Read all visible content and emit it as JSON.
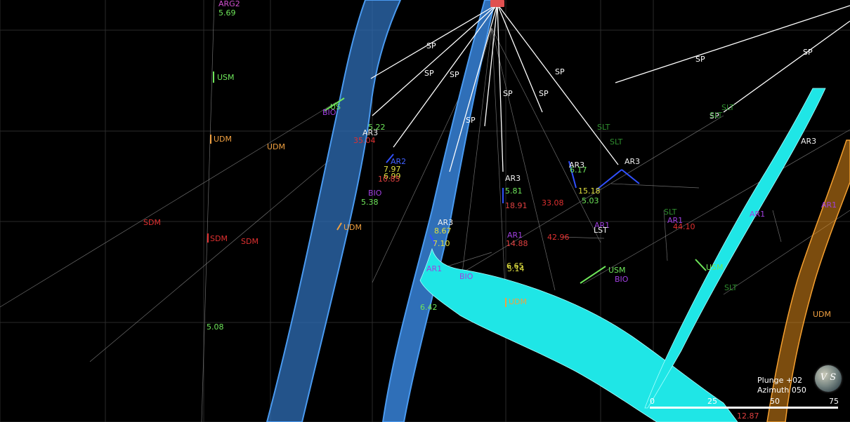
{
  "viewer": {
    "orientation": {
      "plunge_label": "Plunge +02",
      "azimuth_label": "Azimuth 050"
    },
    "compass_label": "V S",
    "scale_bar": {
      "ticks": [
        "0",
        "25",
        "50",
        "75"
      ]
    }
  },
  "colors": {
    "background": "#000000",
    "drillhole_trace": "#ffffff",
    "blue_surface": "#2f6fb8",
    "cyan_surface": "#1fe6e6",
    "orange_surface": "#e08a1a",
    "collar": "#e05050",
    "grid": "#2a2a2a"
  },
  "drillholes": [
    {
      "id": "h1",
      "label": "SP"
    },
    {
      "id": "h2",
      "label": "SP"
    },
    {
      "id": "h3",
      "label": "SP"
    },
    {
      "id": "h4",
      "label": "SP"
    },
    {
      "id": "h5",
      "label": "SP"
    },
    {
      "id": "h6",
      "label": "SP"
    },
    {
      "id": "h7",
      "label": "SP"
    },
    {
      "id": "h8",
      "label": "SP"
    },
    {
      "id": "h9",
      "label": "SP"
    },
    {
      "id": "h10",
      "label": "SP"
    }
  ],
  "labels": [
    {
      "text": "ARG2",
      "color": "#d050d0"
    },
    {
      "text": "5.69",
      "color": "#6ee65a"
    },
    {
      "text": "USM",
      "color": "#6ee65a"
    },
    {
      "text": "UDM",
      "color": "#f0a040"
    },
    {
      "text": "UDM",
      "color": "#f0a040"
    },
    {
      "text": "SDM",
      "color": "#e03030"
    },
    {
      "text": "SDM",
      "color": "#e03030"
    },
    {
      "text": "SDM",
      "color": "#e03030"
    },
    {
      "text": "5.08",
      "color": "#6ee65a"
    },
    {
      "text": "US",
      "color": "#6ee65a"
    },
    {
      "text": "BIO",
      "color": "#a040e0"
    },
    {
      "text": "AR3",
      "color": "#f0f0f0"
    },
    {
      "text": "35.04",
      "color": "#e03030"
    },
    {
      "text": "5.22",
      "color": "#6ee65a"
    },
    {
      "text": "AR2",
      "color": "#4060ff"
    },
    {
      "text": "7.97",
      "color": "#e0e040"
    },
    {
      "text": "6.99",
      "color": "#e0e040"
    },
    {
      "text": "10.85",
      "color": "#e04040"
    },
    {
      "text": "BIO",
      "color": "#a040e0"
    },
    {
      "text": "5.38",
      "color": "#6ee65a"
    },
    {
      "text": "UDM",
      "color": "#f0a040"
    },
    {
      "text": "AR3",
      "color": "#f0f0f0"
    },
    {
      "text": "8.67",
      "color": "#e0e040"
    },
    {
      "text": "7.10",
      "color": "#e0e040"
    },
    {
      "text": "AR1",
      "color": "#a040e0"
    },
    {
      "text": "BIO",
      "color": "#a040e0"
    },
    {
      "text": "6.42",
      "color": "#6ee65a"
    },
    {
      "text": "AR3",
      "color": "#f0f0f0"
    },
    {
      "text": "5.81",
      "color": "#6ee65a"
    },
    {
      "text": "18.91",
      "color": "#e04040"
    },
    {
      "text": "33.08",
      "color": "#e03030"
    },
    {
      "text": "AR1",
      "color": "#a040e0"
    },
    {
      "text": "14.88",
      "color": "#e04040"
    },
    {
      "text": "42.96",
      "color": "#e03030"
    },
    {
      "text": "6.65",
      "color": "#e0e040"
    },
    {
      "text": "5.14",
      "color": "#e0e040"
    },
    {
      "text": "UDM",
      "color": "#f0a040"
    },
    {
      "text": "AR3",
      "color": "#f0f0f0"
    },
    {
      "text": "6.17",
      "color": "#6ee65a"
    },
    {
      "text": "15.18",
      "color": "#e0e040"
    },
    {
      "text": "5.03",
      "color": "#6ee65a"
    },
    {
      "text": "AR3",
      "color": "#f0f0f0"
    },
    {
      "text": "AR1",
      "color": "#a040e0"
    },
    {
      "text": "LST",
      "color": "#f0f0f0"
    },
    {
      "text": "USM",
      "color": "#6ee65a"
    },
    {
      "text": "BIO",
      "color": "#a040e0"
    },
    {
      "text": "SLT",
      "color": "#2f8f2f"
    },
    {
      "text": "SLT",
      "color": "#2f8f2f"
    },
    {
      "text": "SLT",
      "color": "#2f8f2f"
    },
    {
      "text": "SLT",
      "color": "#2f8f2f"
    },
    {
      "text": "SLT",
      "color": "#2f8f2f"
    },
    {
      "text": "AR1",
      "color": "#a040e0"
    },
    {
      "text": "44.10",
      "color": "#e03030"
    },
    {
      "text": "USM",
      "color": "#6ee65a"
    },
    {
      "text": "SLT",
      "color": "#2f8f2f"
    },
    {
      "text": "AR3",
      "color": "#f0f0f0"
    },
    {
      "text": "AR1",
      "color": "#a040e0"
    },
    {
      "text": "AR1",
      "color": "#a040e0"
    },
    {
      "text": "UDM",
      "color": "#f0a040"
    },
    {
      "text": "12.87",
      "color": "#e04040"
    }
  ]
}
